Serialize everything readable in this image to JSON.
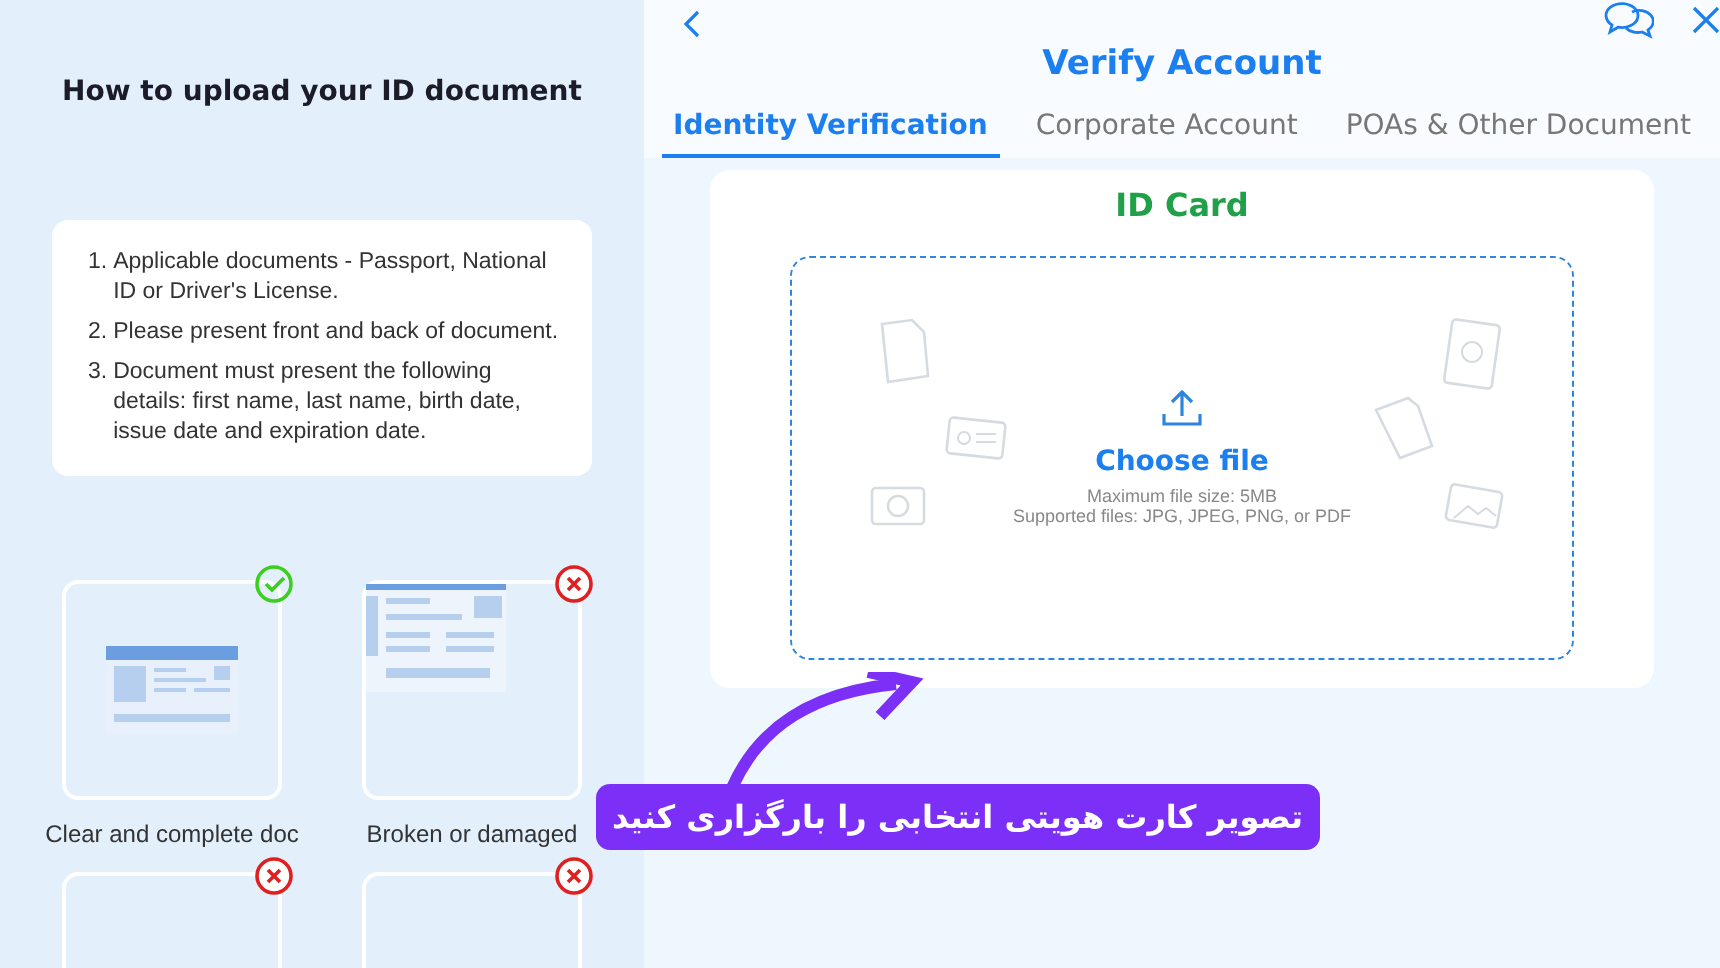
{
  "guide": {
    "title": "How to upload your ID document",
    "rules": [
      {
        "number": "1.",
        "text": "Applicable documents - Passport, National ID or Driver's License."
      },
      {
        "number": "2.",
        "text": "Please present front and back of document."
      },
      {
        "number": "3.",
        "text": "Document must present the following details: first name, last name, birth date, issue date and expiration date."
      }
    ],
    "examples": [
      {
        "label": "Clear and complete doc",
        "kind": "good",
        "accepted": true
      },
      {
        "label": "Broken or damaged",
        "kind": "broken",
        "accepted": false
      },
      {
        "kind": "plain",
        "accepted": false
      },
      {
        "kind": "plain",
        "accepted": false
      }
    ]
  },
  "panel": {
    "title": "Verify Account",
    "tabs": [
      {
        "label": "Identity Verification",
        "selected": true
      },
      {
        "label": "Corporate Account",
        "selected": false
      },
      {
        "label": "POAs & Other Document",
        "selected": false
      }
    ],
    "card": {
      "title": "ID Card",
      "action": "Choose file",
      "max_size": "Maximum file size: 5MB",
      "formats": "Supported files: JPG, JPEG, PNG, or PDF"
    }
  },
  "callout": {
    "text": "تصویر کارت هویتی انتخابی را بارگزاری کنید"
  }
}
